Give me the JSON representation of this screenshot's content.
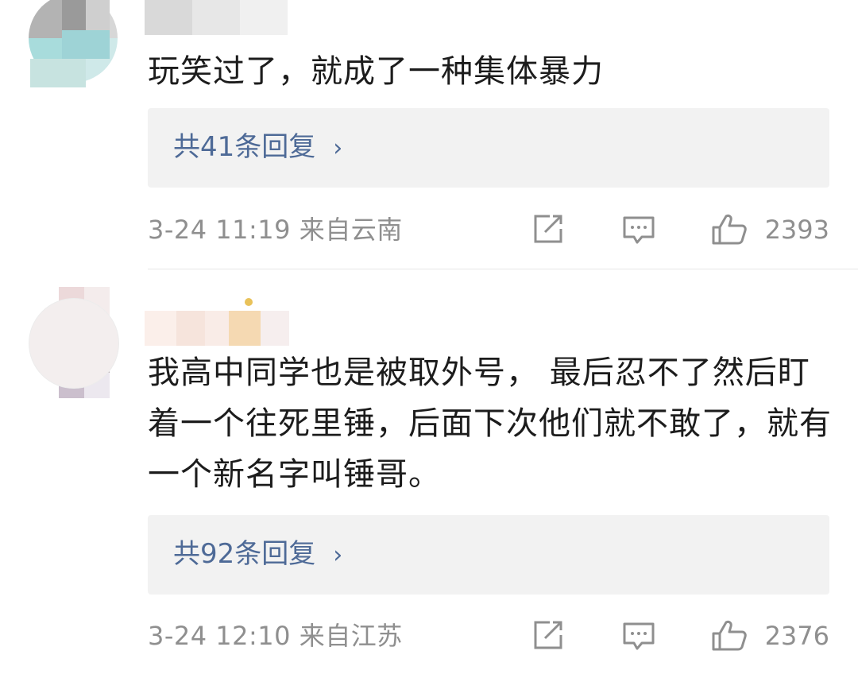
{
  "comments": [
    {
      "text": "玩笑过了，就成了一种集体暴力",
      "reply_link": "共41条回复",
      "reply_chevron": "›",
      "time_location": "3-24 11:19  来自云南",
      "likes": "2393",
      "avatar_colors": [
        "#a7a7a7",
        "#c9d9d9",
        "#9ed3d6",
        "#bfe2e2"
      ]
    },
    {
      "text": "我高中同学也是被取外号，  最后忍不了然后盯着一个往死里锤，后面下次他们就不敢了，就有一个新名字叫锤哥。",
      "reply_link": "共92条回复",
      "reply_chevron": "›",
      "time_location": "3-24 12:10  来自江苏",
      "likes": "2376",
      "avatar_colors": [
        "#e9d6d6",
        "#cfb6ba",
        "#a38b93",
        "#c4b6c2"
      ]
    }
  ],
  "icons": {
    "share": "share-icon",
    "comment": "comment-icon",
    "like": "thumbs-up-icon"
  },
  "colors": {
    "reply_link": "#4e6a97",
    "meta_text": "#8f8f8f",
    "reply_bg": "#f2f2f2"
  }
}
